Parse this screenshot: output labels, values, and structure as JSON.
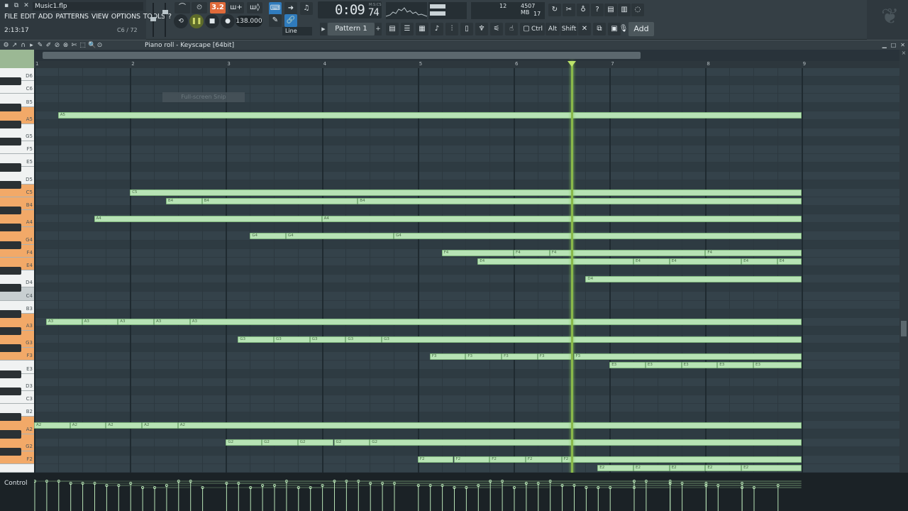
{
  "file": {
    "name": "Music1.flp",
    "song_time": "2:13:17",
    "hint": "C6 / 72"
  },
  "menu": [
    "FILE",
    "EDIT",
    "ADD",
    "PATTERNS",
    "VIEW",
    "OPTIONS",
    "TOOLS",
    "?"
  ],
  "transport": {
    "tempo": "138.000",
    "rec_count": "3.2",
    "clock": "0:09",
    "clock_frac": "74",
    "clock_unit": "M:S:CS"
  },
  "monitor": {
    "cpu_num": "12",
    "memory": "4507 MB",
    "polyphony": "17"
  },
  "pattern": {
    "label": "Pattern 1"
  },
  "snap": {
    "label": "Line"
  },
  "modkeys": [
    "Ctrl",
    "Alt",
    "Shift"
  ],
  "add_label": "Add",
  "piano_roll": {
    "title": "Piano roll - Keyscape [64bit]",
    "snip_text": "Full-screen Snip",
    "control_label": "Control"
  },
  "bars": [
    "1",
    "2",
    "3",
    "4",
    "5",
    "6",
    "7",
    "8",
    "9"
  ],
  "keys": [
    "D6",
    "C#6",
    "C6",
    "B5",
    "A#5",
    "A5",
    "G#5",
    "G5",
    "F#5",
    "F5",
    "E5",
    "D#5",
    "D5",
    "C#5",
    "C5",
    "B4",
    "A#4",
    "A4",
    "G#4",
    "G4",
    "F#4",
    "F4",
    "E4",
    "D#4",
    "D4",
    "C#4",
    "C4",
    "B3",
    "A#3",
    "A3",
    "G#3",
    "G3",
    "F#3",
    "F3",
    "E3",
    "D#3",
    "D3",
    "C#3",
    "C3",
    "B2",
    "A#2",
    "A2",
    "G#2",
    "G2",
    "F#2",
    "F2",
    "E2"
  ],
  "key_labels": {
    "D6": "D6",
    "C6": "C6",
    "B5": "B5",
    "A5": "A5",
    "G5": "G5",
    "F5": "F5",
    "E5": "E5",
    "D5": "D5",
    "C5": "C5",
    "B4": "B4",
    "A4": "A4",
    "G4": "G4",
    "F4": "F4",
    "E4": "E4",
    "D4": "D4",
    "C4": "C4",
    "B3": "B3",
    "A3": "A3",
    "G3": "G3",
    "F3": "F3",
    "E3": "E3",
    "D3": "D3",
    "C3": "C3",
    "B2": "B2",
    "A2": "A2",
    "G2": "G2",
    "F2": "F2"
  },
  "highlighted_keys": [
    "A5",
    "C5",
    "B4",
    "A4",
    "G4",
    "F4",
    "E4",
    "A3",
    "G3",
    "F3",
    "A2",
    "G2",
    "F2"
  ],
  "notes": [
    {
      "key": "A5",
      "start": 1.25,
      "end": 9.0
    },
    {
      "key": "C5",
      "start": 2.0,
      "end": 9.0
    },
    {
      "key": "B4",
      "start": 2.375,
      "end": 2.75
    },
    {
      "key": "B4",
      "start": 2.75,
      "end": 4.375
    },
    {
      "key": "B4",
      "start": 4.375,
      "end": 9.0
    },
    {
      "key": "A4",
      "start": 1.625,
      "end": 4.0
    },
    {
      "key": "A4",
      "start": 4.0,
      "end": 9.0
    },
    {
      "key": "G4",
      "start": 3.25,
      "end": 3.625
    },
    {
      "key": "G4",
      "start": 3.625,
      "end": 4.75
    },
    {
      "key": "G4",
      "start": 4.75,
      "end": 9.0
    },
    {
      "key": "F4",
      "start": 5.25,
      "end": 6.0
    },
    {
      "key": "F4",
      "start": 6.0,
      "end": 6.375
    },
    {
      "key": "F4",
      "start": 6.375,
      "end": 8.0
    },
    {
      "key": "F4",
      "start": 8.0,
      "end": 9.0
    },
    {
      "key": "E4",
      "start": 5.625,
      "end": 7.25
    },
    {
      "key": "E4",
      "start": 7.25,
      "end": 7.625
    },
    {
      "key": "E4",
      "start": 7.625,
      "end": 8.375
    },
    {
      "key": "E4",
      "start": 8.375,
      "end": 8.75
    },
    {
      "key": "E4",
      "start": 8.75,
      "end": 9.0
    },
    {
      "key": "D4",
      "start": 6.75,
      "end": 9.0
    },
    {
      "key": "A3",
      "start": 1.125,
      "end": 1.5
    },
    {
      "key": "A3",
      "start": 1.5,
      "end": 1.875
    },
    {
      "key": "A3",
      "start": 1.875,
      "end": 2.25
    },
    {
      "key": "A3",
      "start": 2.25,
      "end": 2.625
    },
    {
      "key": "A3",
      "start": 2.625,
      "end": 9.0
    },
    {
      "key": "G3",
      "start": 3.125,
      "end": 3.5
    },
    {
      "key": "G3",
      "start": 3.5,
      "end": 3.875
    },
    {
      "key": "G3",
      "start": 3.875,
      "end": 4.25
    },
    {
      "key": "G3",
      "start": 4.25,
      "end": 4.625
    },
    {
      "key": "G3",
      "start": 4.625,
      "end": 9.0
    },
    {
      "key": "F3",
      "start": 5.125,
      "end": 5.5
    },
    {
      "key": "F3",
      "start": 5.5,
      "end": 5.875
    },
    {
      "key": "F3",
      "start": 5.875,
      "end": 6.25
    },
    {
      "key": "F3",
      "start": 6.25,
      "end": 6.625
    },
    {
      "key": "F3",
      "start": 6.625,
      "end": 9.0
    },
    {
      "key": "E3",
      "start": 7.0,
      "end": 7.375
    },
    {
      "key": "E3",
      "start": 7.375,
      "end": 7.75
    },
    {
      "key": "E3",
      "start": 7.75,
      "end": 8.125
    },
    {
      "key": "E3",
      "start": 8.125,
      "end": 8.5
    },
    {
      "key": "E3",
      "start": 8.5,
      "end": 9.0
    },
    {
      "key": "A2",
      "start": 1.0,
      "end": 1.375
    },
    {
      "key": "A2",
      "start": 1.375,
      "end": 1.75
    },
    {
      "key": "A2",
      "start": 1.75,
      "end": 2.125
    },
    {
      "key": "A2",
      "start": 2.125,
      "end": 2.5
    },
    {
      "key": "A2",
      "start": 2.5,
      "end": 9.0
    },
    {
      "key": "G2",
      "start": 3.0,
      "end": 3.375
    },
    {
      "key": "G2",
      "start": 3.375,
      "end": 3.75
    },
    {
      "key": "G2",
      "start": 3.75,
      "end": 4.125
    },
    {
      "key": "G2",
      "start": 4.125,
      "end": 4.5
    },
    {
      "key": "G2",
      "start": 4.5,
      "end": 9.0
    },
    {
      "key": "F2",
      "start": 5.0,
      "end": 5.375
    },
    {
      "key": "F2",
      "start": 5.375,
      "end": 5.75
    },
    {
      "key": "F2",
      "start": 5.75,
      "end": 6.125
    },
    {
      "key": "F2",
      "start": 6.125,
      "end": 6.5
    },
    {
      "key": "F2",
      "start": 6.5,
      "end": 9.0
    },
    {
      "key": "E2",
      "start": 6.875,
      "end": 7.25
    },
    {
      "key": "E2",
      "start": 7.25,
      "end": 7.625
    },
    {
      "key": "E2",
      "start": 7.625,
      "end": 8.0
    },
    {
      "key": "E2",
      "start": 8.0,
      "end": 8.375
    },
    {
      "key": "E2",
      "start": 8.375,
      "end": 9.0
    }
  ],
  "playhead_position": 6.6,
  "colors": {
    "note": "#b7e3b5",
    "accent": "#f2a968",
    "playhead": "#89b84a",
    "grid": "#34424a"
  }
}
